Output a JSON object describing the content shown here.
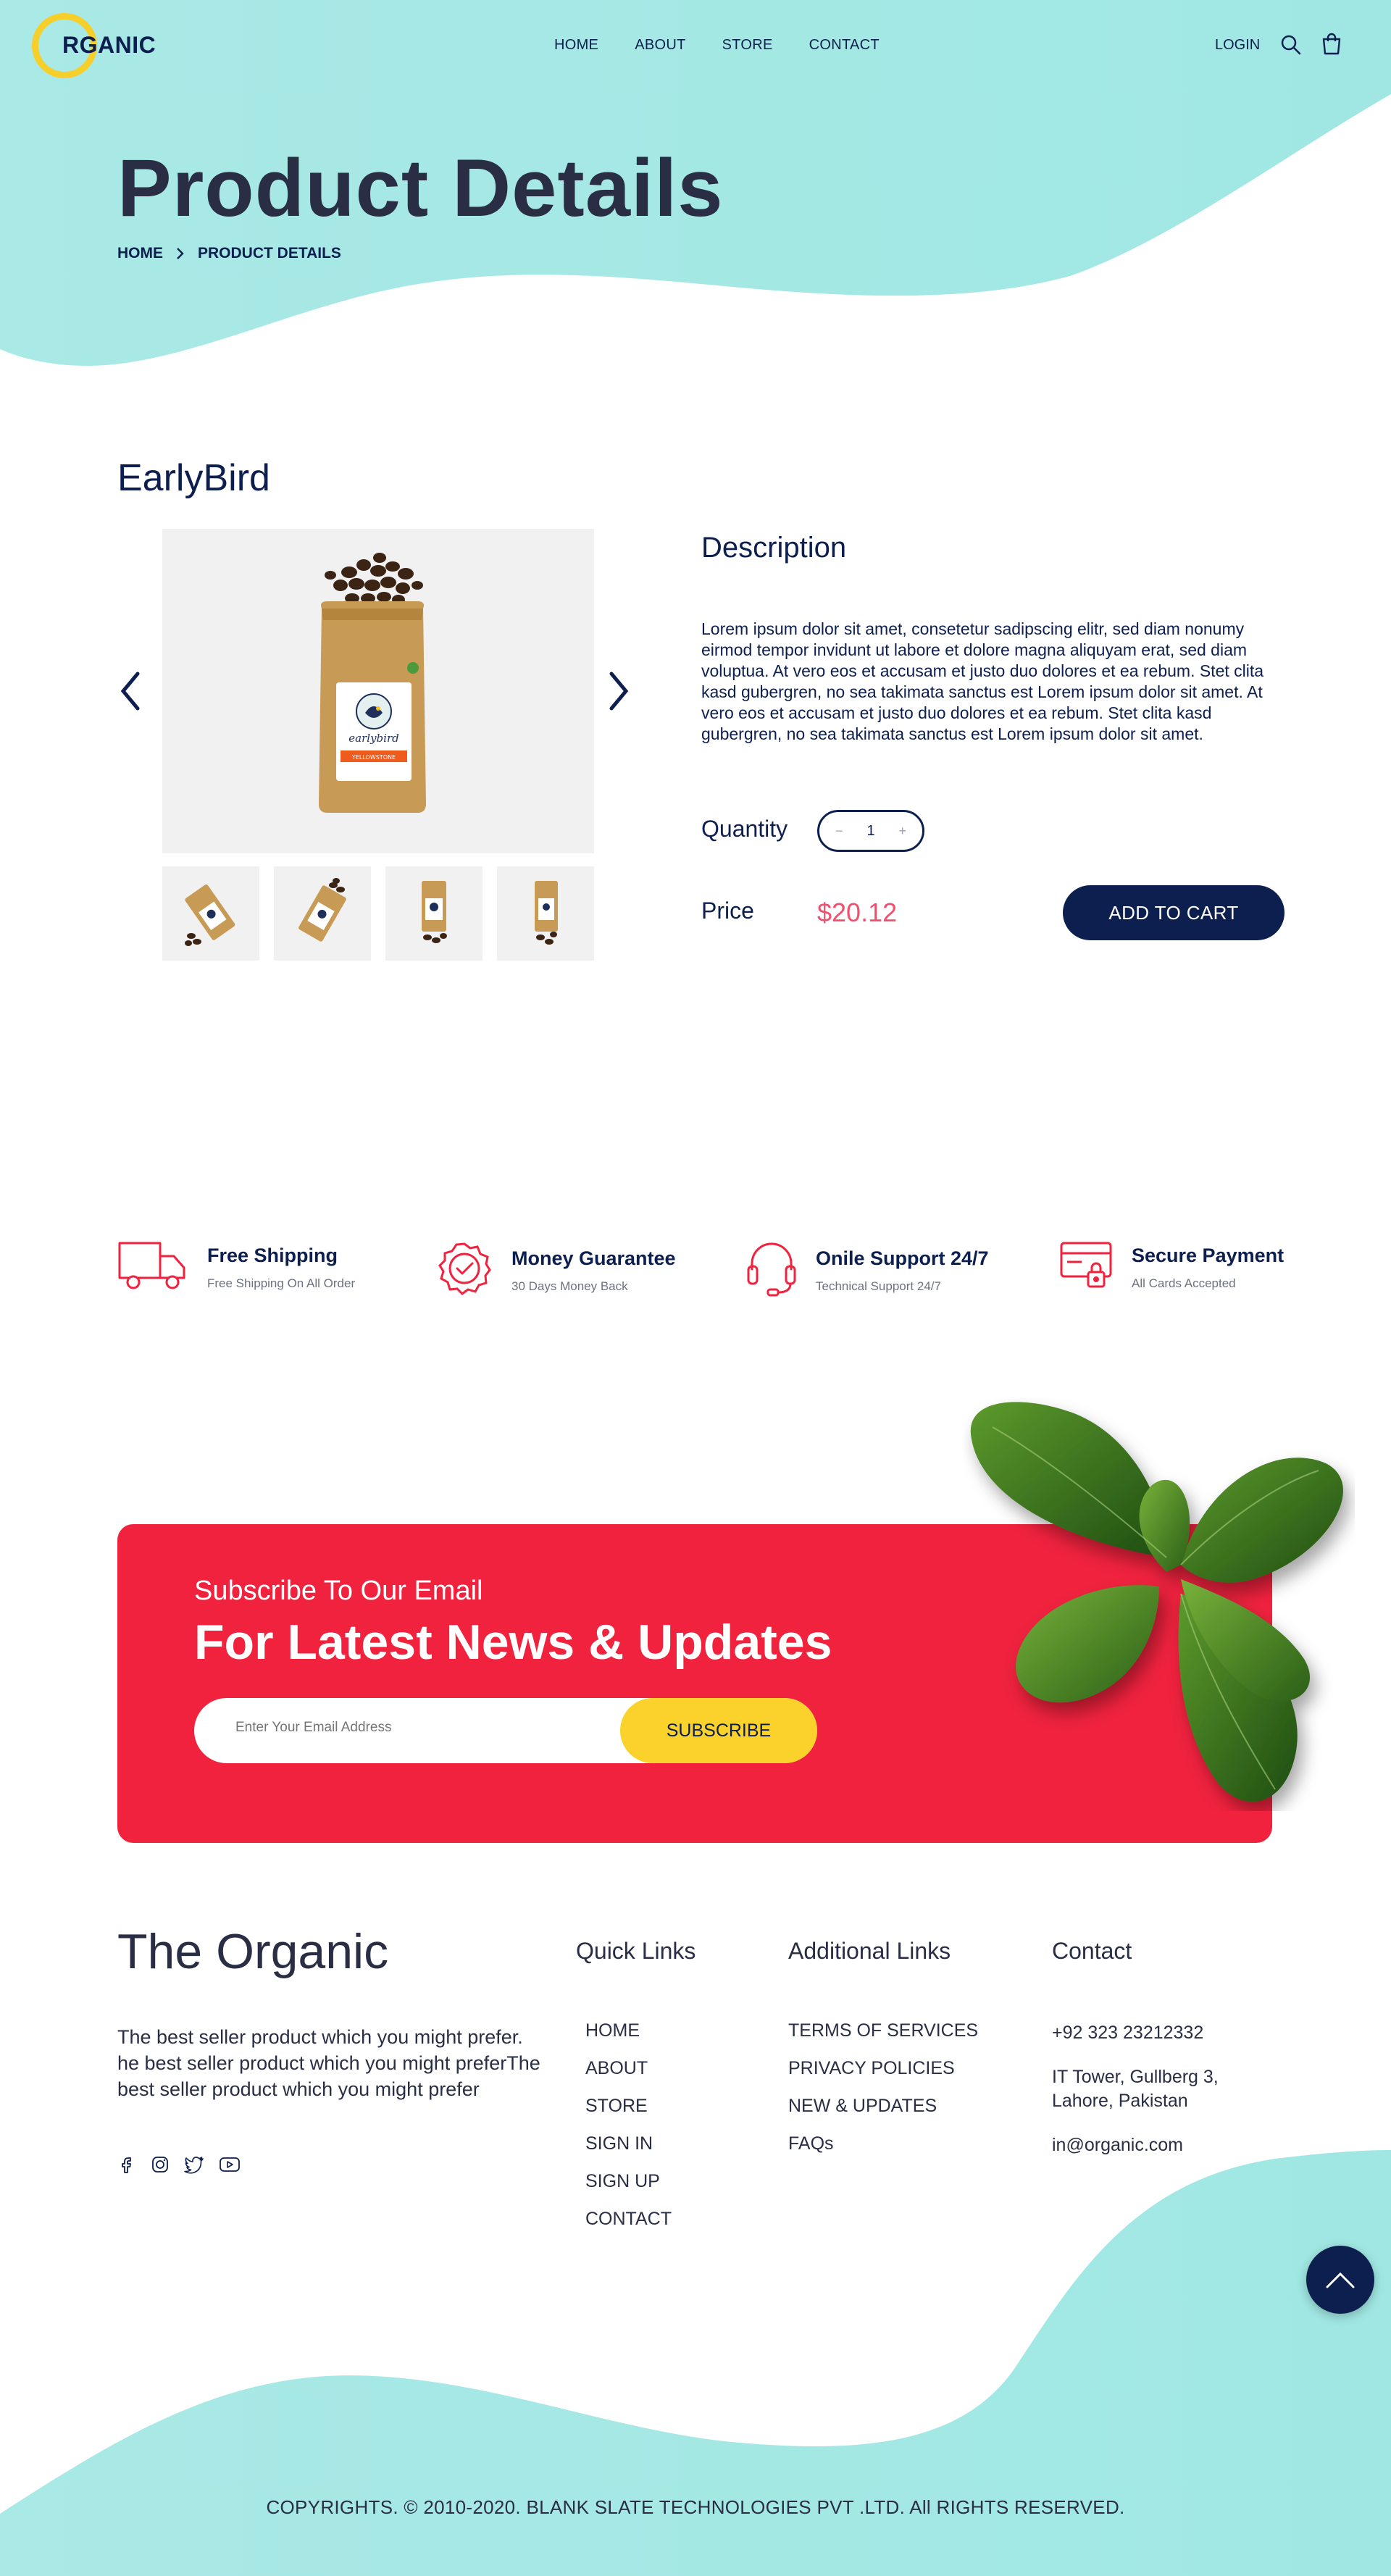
{
  "brand": {
    "logo_text": "RGANIC"
  },
  "nav": {
    "items": [
      "HOME",
      "ABOUT",
      "STORE",
      "CONTACT"
    ],
    "login": "LOGIN"
  },
  "icons": {
    "search": "search-icon",
    "cart": "bag-icon"
  },
  "hero": {
    "title": "Product Details",
    "breadcrumb": [
      "HOME",
      "PRODUCT DETAILS"
    ]
  },
  "product": {
    "name": "EarlyBird",
    "description_title": "Description",
    "description": "Lorem ipsum dolor sit amet, consetetur sadipscing elitr, sed diam nonumy eirmod tempor invidunt ut labore et dolore magna aliquyam erat, sed diam voluptua. At vero eos et accusam et justo duo dolores et ea rebum. Stet clita kasd gubergren, no sea takimata sanctus est Lorem ipsum dolor sit amet. At vero eos et accusam et justo duo dolores et ea rebum. Stet clita kasd gubergren, no sea takimata sanctus est Lorem ipsum dolor sit amet.",
    "quantity_label": "Quantity",
    "quantity": "1",
    "qty_minus": "−",
    "qty_plus": "+",
    "price_label": "Price",
    "price": "$20.12",
    "add_to_cart": "ADD TO CART",
    "bag_label": "earlybird",
    "bag_band": "YELLOWSTONE"
  },
  "features": [
    {
      "title": "Free Shipping",
      "sub": "Free Shipping On All Order",
      "icon": "truck-icon"
    },
    {
      "title": "Money Guarantee",
      "sub": "30 Days Money Back",
      "icon": "badge-check-icon"
    },
    {
      "title": "Onile Support 24/7",
      "sub": "Technical Support 24/7",
      "icon": "headset-icon"
    },
    {
      "title": "Secure Payment",
      "sub": "All Cards Accepted",
      "icon": "card-lock-icon"
    }
  ],
  "subscribe": {
    "small": "Subscribe To Our Email",
    "big": "For Latest News & Updates",
    "placeholder": "Enter Your Email Address",
    "button": "SUBSCRIBE"
  },
  "footer": {
    "brand": "The Organic",
    "desc": "The best seller product which you might prefer. he best seller product which you might preferThe best seller product which you might prefer",
    "quick_title": "Quick Links",
    "quick_links": [
      "HOME",
      "ABOUT",
      "STORE",
      "SIGN IN",
      "SIGN UP",
      "CONTACT"
    ],
    "add_title": "Additional Links",
    "add_links": [
      "TERMS OF SERVICES",
      "PRIVACY POLICIES",
      "NEW & UPDATES",
      "FAQs"
    ],
    "contact_title": "Contact",
    "contact": [
      "+92 323 23212332",
      "IT Tower, Gullberg 3, Lahore, Pakistan",
      "in@organic.com"
    ],
    "social": [
      "facebook-icon",
      "instagram-icon",
      "twitter-icon",
      "youtube-icon"
    ],
    "copyright": "COPYRIGHTS. © 2010-2020. BLANK SLATE TECHNOLOGIES PVT .LTD. All RIGHTS RESERVED."
  },
  "colors": {
    "teal": "#a4e8e4",
    "navy": "#0d1f4f",
    "red": "#f0223e",
    "yellow": "#fbd12c",
    "price": "#f0506e"
  }
}
